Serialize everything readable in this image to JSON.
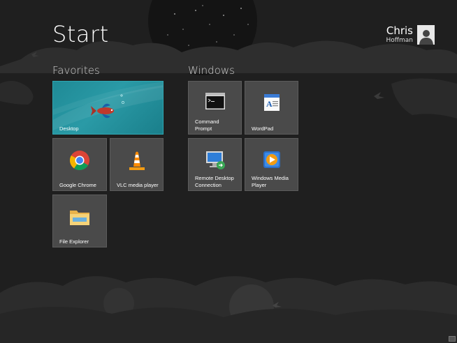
{
  "header": {
    "title": "Start"
  },
  "user": {
    "first_name": "Chris",
    "last_name": "Hoffman"
  },
  "groups": [
    {
      "name": "Favorites"
    },
    {
      "name": "Windows"
    }
  ],
  "tiles": {
    "desktop": "Desktop",
    "chrome": "Google Chrome",
    "vlc": "VLC media player",
    "explorer": "File Explorer",
    "cmd": "Command Prompt",
    "wordpad": "WordPad",
    "rdp": "Remote Desktop Connection",
    "wmp": "Windows Media Player"
  },
  "icons": {
    "desktop": "desktop-fish-icon",
    "chrome": "chrome-icon",
    "vlc": "vlc-cone-icon",
    "explorer": "folder-icon",
    "cmd": "command-prompt-icon",
    "wordpad": "wordpad-icon",
    "rdp": "remote-desktop-icon",
    "wmp": "windows-media-player-icon",
    "avatar": "user-silhouette-icon"
  },
  "colors": {
    "background": "#1f1f1f",
    "tile": "#4a4a4a",
    "desktop_tile": "#1f8a96"
  }
}
